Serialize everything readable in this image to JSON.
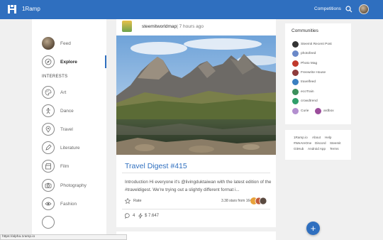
{
  "header": {
    "app_title": "1Ramp",
    "competitions": "Competitions"
  },
  "sidebar": {
    "items": [
      {
        "label": "Feed"
      },
      {
        "label": "Explore"
      }
    ],
    "interests_title": "INTERESTS",
    "interests": [
      {
        "label": "Art",
        "icon": "palette-icon"
      },
      {
        "label": "Dance",
        "icon": "dancer-icon"
      },
      {
        "label": "Travel",
        "icon": "map-pin-icon"
      },
      {
        "label": "Literature",
        "icon": "pen-icon"
      },
      {
        "label": "Film",
        "icon": "clapperboard-icon"
      },
      {
        "label": "Photography",
        "icon": "camera-icon"
      },
      {
        "label": "Fashion",
        "icon": "eye-icon"
      }
    ]
  },
  "post": {
    "author": "steemitworldmap",
    "time": " | 7 hours ago",
    "title": "Travel Digest #415",
    "excerpt": "Introduction Hi everyone it's @livingduktaiwan with the latest edition of the #traveldigest. We're trying out a slightly different format i...",
    "rate_label": "Rate",
    "stars_from": "3.38 stars from 164",
    "comments": "4",
    "payout": "$ 7.647"
  },
  "communities": {
    "title": "Communities",
    "items": [
      {
        "label": "Steemit Recent Post",
        "color": "#333333"
      },
      {
        "label": "photofeed",
        "color": "#6a88c8"
      },
      {
        "label": "Photo Mag",
        "color": "#c0392b"
      },
      {
        "label": "Freewrite House",
        "color": "#8e3b3b"
      },
      {
        "label": "travelfeed",
        "color": "#3a7fc1"
      },
      {
        "label": "ecoTrain",
        "color": "#3b8f5b"
      },
      {
        "label": "crowdtrend",
        "color": "#2f9e6a"
      },
      {
        "label": "Curie",
        "color": "#b38fcf"
      },
      {
        "label": "ardbox",
        "color": "#9b4d9b"
      }
    ]
  },
  "footer_links": [
    "1Ramp.io",
    "About",
    "Help",
    "#WeAreOne",
    "Discord",
    "Steemit",
    "GitHub",
    "Android App",
    "Terms"
  ],
  "status_url": "https://alpha.1ramp.io",
  "colors": {
    "brand": "#2f6fbf"
  }
}
